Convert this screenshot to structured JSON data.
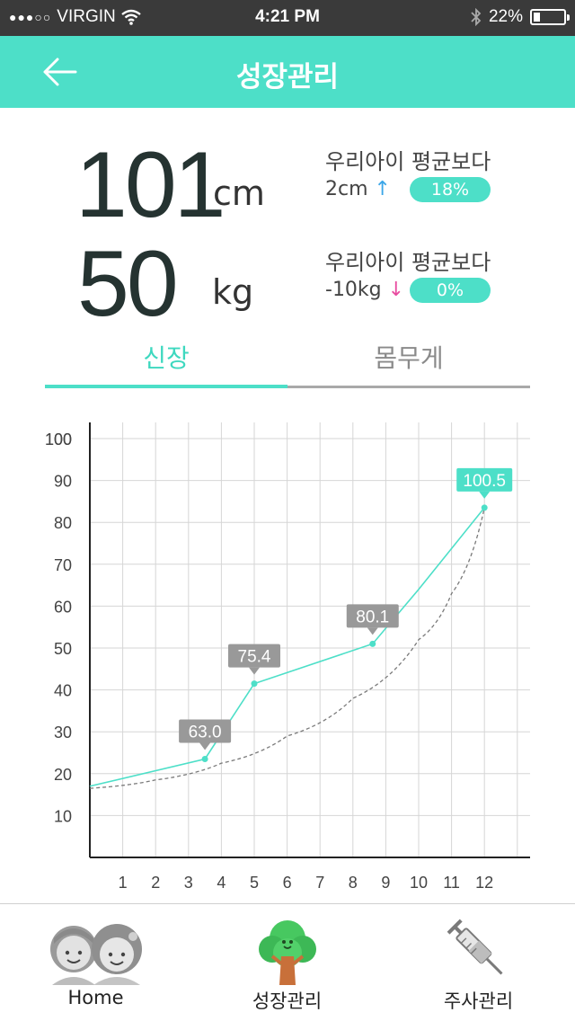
{
  "status_bar": {
    "carrier": "VIRGIN",
    "time": "4:21 PM",
    "battery": "22%",
    "battery_level": 0.22
  },
  "header": {
    "title": "성장관리",
    "back_icon": "arrow-left-icon",
    "background": "#4ddfc8"
  },
  "height": {
    "value": "101",
    "unit": "cm",
    "avg_label": "우리아이 평균보다",
    "diff": "2cm",
    "arrow": "↑",
    "percent": "18%"
  },
  "weight": {
    "value": "50",
    "unit": "kg",
    "avg_label": "우리아이 평균보다",
    "diff": "-10kg",
    "arrow": "↓",
    "percent": "0%"
  },
  "tabs": [
    {
      "label": "신장",
      "active": true
    },
    {
      "label": "몸무게",
      "active": false
    }
  ],
  "chart_data": {
    "type": "line",
    "xlim": [
      0,
      13
    ],
    "ylim": [
      0,
      105
    ],
    "x_ticks": [
      1,
      2,
      3,
      4,
      5,
      6,
      7,
      8,
      9,
      10,
      11,
      12
    ],
    "y_ticks": [
      10,
      20,
      30,
      40,
      50,
      60,
      70,
      80,
      90,
      100
    ],
    "grid": true,
    "series": [
      {
        "color": "#4ddfc8",
        "style": "solid",
        "points": [
          [
            0,
            17
          ],
          [
            3.5,
            23.5
          ],
          [
            5,
            41.5
          ],
          [
            8.6,
            51
          ],
          [
            10,
            64
          ],
          [
            12,
            83.5
          ]
        ]
      },
      {
        "color": "#7a7a7a",
        "style": "dashed",
        "points": [
          [
            0,
            16.5
          ],
          [
            2,
            18.5
          ],
          [
            4,
            22.5
          ],
          [
            6,
            29
          ],
          [
            8,
            38
          ],
          [
            10,
            52
          ],
          [
            11,
            63
          ],
          [
            12,
            83.5
          ]
        ]
      }
    ],
    "callouts": [
      {
        "x": 3.5,
        "y": 23.5,
        "label": "63.0",
        "color": "#999999"
      },
      {
        "x": 5,
        "y": 41.5,
        "label": "75.4",
        "color": "#999999"
      },
      {
        "x": 8.6,
        "y": 51,
        "label": "80.1",
        "color": "#999999"
      },
      {
        "x": 12,
        "y": 83.5,
        "label": "100.5",
        "color": "#4ddfc8"
      }
    ]
  },
  "bottom_nav": [
    {
      "label": "Home",
      "icon": "family-icon"
    },
    {
      "label": "성장관리",
      "icon": "tree-icon"
    },
    {
      "label": "주사관리",
      "icon": "syringe-icon"
    }
  ]
}
